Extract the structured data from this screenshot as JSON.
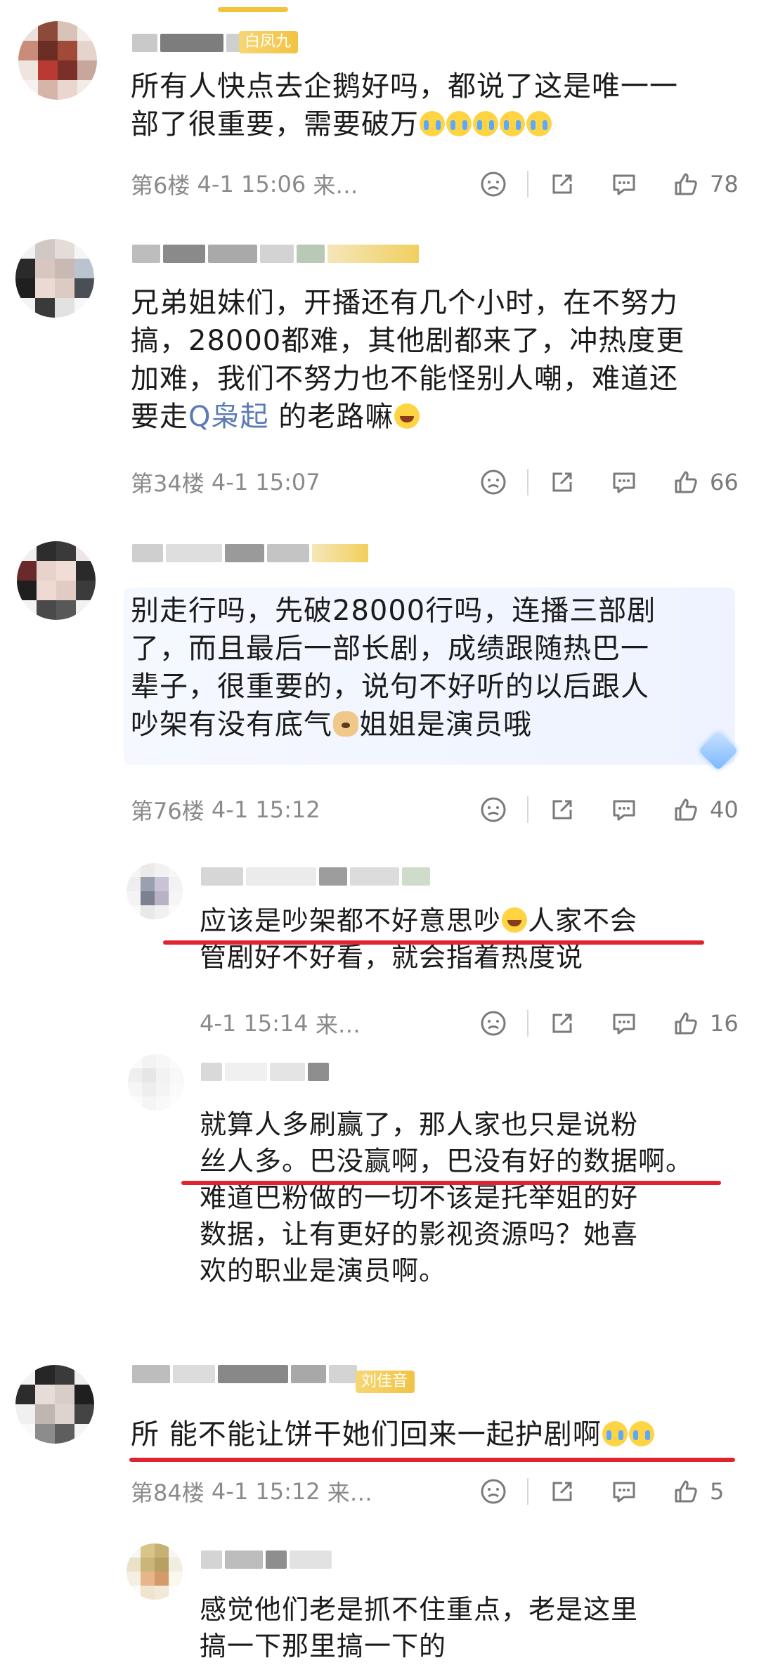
{
  "colors": {
    "accent_red": "#e0242f",
    "badge_gold": "#f2c343",
    "topic_blue": "#5b7bb5"
  },
  "comments": [
    {
      "badge": "白凤九",
      "text": [
        [
          {
            "t": "所有人快点去企鹅好吗，都说了这是唯一一"
          }
        ],
        [
          {
            "t": "部了很重要，需要破万"
          },
          {
            "emoji": "cry"
          },
          {
            "emoji": "cry"
          },
          {
            "emoji": "cry"
          },
          {
            "emoji": "cry"
          },
          {
            "emoji": "cry"
          }
        ]
      ],
      "floor": "第6楼",
      "time": "4-1 15:06",
      "source": "来…",
      "likes": "78"
    },
    {
      "badge": "",
      "text": [
        [
          {
            "t": "兄弟姐妹们，开播还有几个小时，在不努力"
          }
        ],
        [
          {
            "t": "搞，28000都难，其他剧都来了，冲热度更"
          }
        ],
        [
          {
            "t": "加难，我们不努力也不能怪别人嘲，难道还"
          }
        ],
        [
          {
            "t": "要走"
          },
          {
            "topic": "Q枭起"
          },
          {
            "t": " 的老路嘛"
          },
          {
            "emoji": "laugh"
          }
        ]
      ],
      "floor": "第34楼",
      "time": "4-1 15:07",
      "source": "",
      "likes": "66"
    },
    {
      "badge": "",
      "text": [
        [
          {
            "t": "别走行吗，先破28000行吗，连播三部剧"
          }
        ],
        [
          {
            "t": "了，而且最后一部长剧，成绩跟随热巴一"
          }
        ],
        [
          {
            "t": "辈子，很重要的，说句不好听的以后跟人"
          }
        ],
        [
          {
            "t": "吵架有没有底气"
          },
          {
            "emoji": "dog"
          },
          {
            "t": "姐姐是演员哦"
          }
        ]
      ],
      "floor": "第76楼",
      "time": "4-1 15:12",
      "source": "",
      "likes": "40"
    },
    {
      "badge": "",
      "text": [
        [
          {
            "t": "应该是吵架都不好意思吵"
          },
          {
            "emoji": "laugh"
          },
          {
            "t": "人家不会"
          }
        ],
        [
          {
            "t": "管剧好不好看，就会指着热度说"
          }
        ]
      ],
      "floor": "",
      "time": "4-1 15:14",
      "source": "来…",
      "likes": "16"
    },
    {
      "badge": "",
      "text": [
        [
          {
            "t": "就算人多刷赢了，那人家也只是说粉"
          }
        ],
        [
          {
            "t": "丝人多。巴没赢啊，巴没有好的数据啊。"
          }
        ],
        [
          {
            "t": "难道巴粉做的一切不该是托举姐的好"
          }
        ],
        [
          {
            "t": "数据，让有更好的影视资源吗？她喜"
          }
        ],
        [
          {
            "t": "欢的职业是演员啊。"
          }
        ]
      ]
    },
    {
      "badge": "刘佳音",
      "text": [
        [
          {
            "t": "所 能不能让饼干她们回来一起护剧啊"
          },
          {
            "emoji": "cry"
          },
          {
            "emoji": "cry"
          }
        ]
      ],
      "floor": "第84楼",
      "time": "4-1 15:12",
      "source": "来…",
      "likes": "5"
    },
    {
      "badge": "",
      "text": [
        [
          {
            "t": "感觉他们老是抓不住重点，老是这里"
          }
        ],
        [
          {
            "t": "搞一下那里搞一下的"
          }
        ]
      ]
    }
  ]
}
